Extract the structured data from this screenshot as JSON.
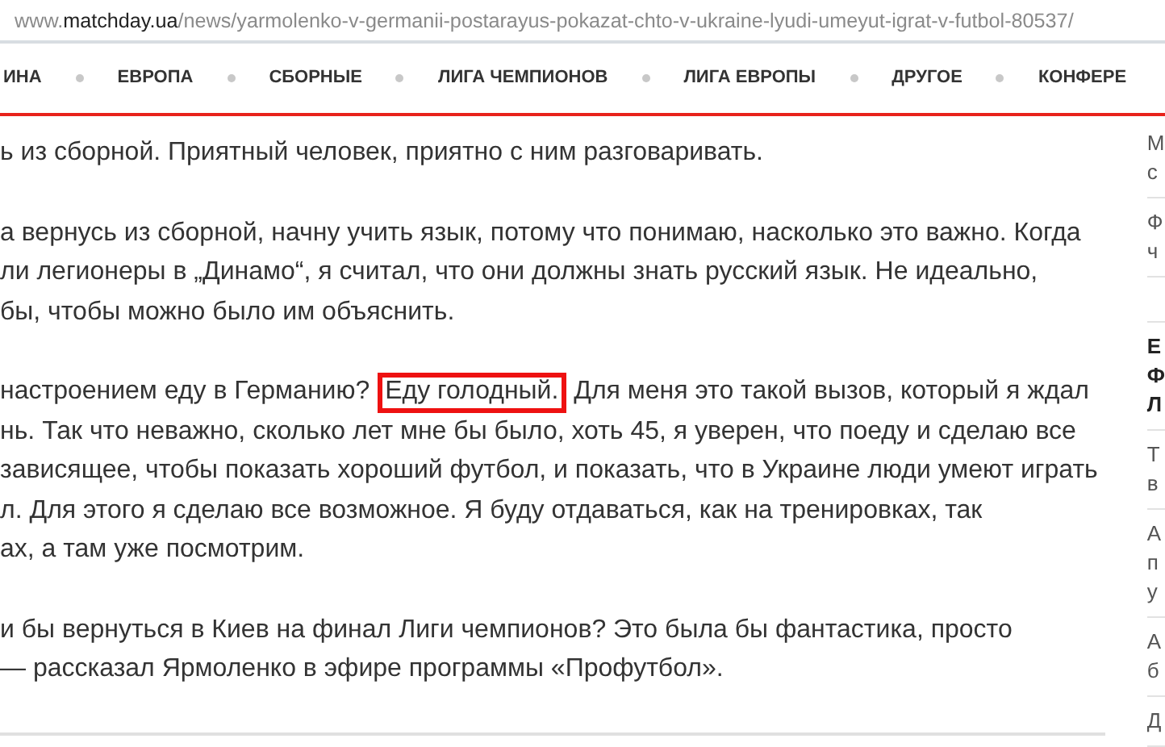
{
  "address_bar": {
    "prefix": "www.",
    "domain": "matchday.ua",
    "path": "/news/yarmolenko-v-germanii-postarayus-pokazat-chto-v-ukraine-lyudi-umeyut-igrat-v-futbol-80537/"
  },
  "nav": [
    "ИНА",
    "ЕВРОПА",
    "СБОРНЫЕ",
    "ЛИГА ЧЕМПИОНОВ",
    "ЛИГА ЕВРОПЫ",
    "ДРУГОЕ",
    "КОНФЕРЕ"
  ],
  "article": [
    {
      "lines": [
        [
          {
            "text": "ь из сборной. Приятный человек, приятно с ним разговаривать.",
            "boxed": false
          }
        ]
      ]
    },
    {
      "lines": [
        [
          {
            "text": "а вернусь из сборной, начну учить язык, потому что понимаю, насколько это важно. Когда",
            "boxed": false
          }
        ],
        [
          {
            "text": "ли легионеры в „Динамо“, я считал, что они должны знать русский язык. Не идеально,",
            "boxed": false
          }
        ],
        [
          {
            "text": "бы, чтобы можно было им объяснить.",
            "boxed": false
          }
        ]
      ]
    },
    {
      "lines": [
        [
          {
            "text": "настроением еду в Германию? ",
            "boxed": false
          },
          {
            "text": "Еду голодный.",
            "boxed": true
          },
          {
            "text": " Для меня это такой вызов, который я ждал",
            "boxed": false
          }
        ],
        [
          {
            "text": "нь. Так что неважно, сколько лет мне бы было, хоть 45, я уверен, что поеду и сделаю все",
            "boxed": false
          }
        ],
        [
          {
            "text": "зависящее, чтобы показать хороший футбол, и показать, что в Украине люди умеют играть",
            "boxed": false
          }
        ],
        [
          {
            "text": "л. Для этого я сделаю все возможное. Я буду отдаваться, как на тренировках, так",
            "boxed": false
          }
        ],
        [
          {
            "text": "ах, а там уже посмотрим.",
            "boxed": false
          }
        ]
      ]
    },
    {
      "lines": [
        [
          {
            "text": "и бы вернуться в Киев на финал Лиги чемпионов? Это была бы фантастика, просто",
            "boxed": false
          }
        ],
        [
          {
            "text": "— рассказал Ярмоленко в эфире программы «Профутбол».",
            "boxed": false
          }
        ]
      ]
    }
  ],
  "sidebar": [
    {
      "lines": [
        "М",
        "с"
      ],
      "bold": false
    },
    {
      "lines": [
        "Ф",
        "ч"
      ],
      "bold": false
    },
    {
      "lines": [
        "Е",
        "Ф",
        "Л"
      ],
      "bold": true
    },
    {
      "lines": [
        "Т",
        "в"
      ],
      "bold": false
    },
    {
      "lines": [
        "А",
        "п",
        "у"
      ],
      "bold": false
    },
    {
      "lines": [
        "А",
        "б"
      ],
      "bold": false
    },
    {
      "lines": [
        "Д"
      ],
      "bold": false
    }
  ]
}
